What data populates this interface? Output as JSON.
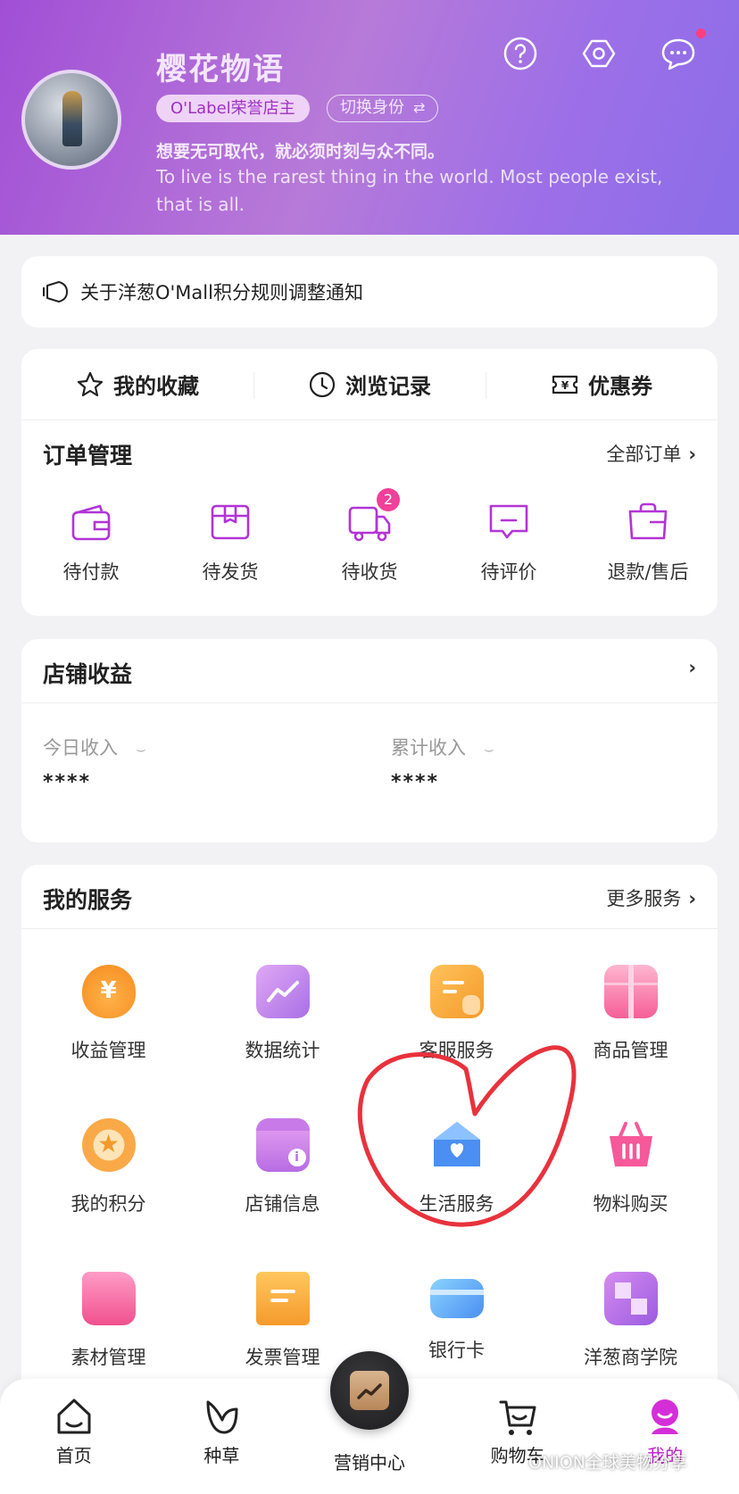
{
  "profile": {
    "username": "樱花物语",
    "badge": "O'Label荣誉店主",
    "switch_label": "切换身份",
    "motto": "想要无可取代，就必须时刻与众不同。",
    "motto_en": "To live is the rarest thing in the world. Most people exist, that is all."
  },
  "header_icons": [
    "help-icon",
    "settings-icon",
    "message-icon"
  ],
  "notice": {
    "text": "关于洋葱O'Mall积分规则调整通知",
    "icon": "megaphone-icon"
  },
  "quick_actions": [
    {
      "label": "我的收藏",
      "icon": "star-icon"
    },
    {
      "label": "浏览记录",
      "icon": "clock-icon"
    },
    {
      "label": "优惠券",
      "icon": "coupon-icon"
    }
  ],
  "orders": {
    "title": "订单管理",
    "more": "全部订单",
    "chevron": "›",
    "items": [
      {
        "label": "待付款",
        "icon": "wallet-icon",
        "count": ""
      },
      {
        "label": "待发货",
        "icon": "box-icon",
        "count": ""
      },
      {
        "label": "待收货",
        "icon": "truck-icon",
        "count": "2"
      },
      {
        "label": "待评价",
        "icon": "comment-icon",
        "count": ""
      },
      {
        "label": "退款/售后",
        "icon": "refund-bag-icon",
        "count": ""
      }
    ]
  },
  "income": {
    "title": "店铺收益",
    "chevron": "›",
    "today_label": "今日收入",
    "today_value": "****",
    "total_label": "累计收入",
    "total_value": "****",
    "eye": "⌣"
  },
  "services": {
    "title": "我的服务",
    "more": "更多服务",
    "chevron": "›",
    "items": [
      {
        "label": "收益管理",
        "icon": "money-bag-icon"
      },
      {
        "label": "数据统计",
        "icon": "chart-icon"
      },
      {
        "label": "客服服务",
        "icon": "customer-service-icon"
      },
      {
        "label": "商品管理",
        "icon": "gift-box-icon"
      },
      {
        "label": "我的积分",
        "icon": "points-star-icon"
      },
      {
        "label": "店铺信息",
        "icon": "shop-info-icon"
      },
      {
        "label": "生活服务",
        "icon": "house-heart-icon"
      },
      {
        "label": "物料购买",
        "icon": "basket-icon"
      },
      {
        "label": "素材管理",
        "icon": "folder-icon"
      },
      {
        "label": "发票管理",
        "icon": "invoice-icon"
      },
      {
        "label": "银行卡",
        "icon": "bank-card-icon"
      },
      {
        "label": "洋葱商学院",
        "icon": "academy-icon"
      }
    ]
  },
  "nav": [
    {
      "label": "首页",
      "icon": "home-icon"
    },
    {
      "label": "种草",
      "icon": "leaf-icon"
    },
    {
      "label": "营销中心",
      "icon": "marketing-icon"
    },
    {
      "label": "购物车",
      "icon": "cart-icon"
    },
    {
      "label": "我的",
      "icon": "profile-icon"
    }
  ],
  "watermark": "ONION全球美物分享",
  "colors": {
    "accent": "#c020c8",
    "order_icon": "#b234d6",
    "badge_red": "#f0409a",
    "annotation": "#e8323c"
  }
}
